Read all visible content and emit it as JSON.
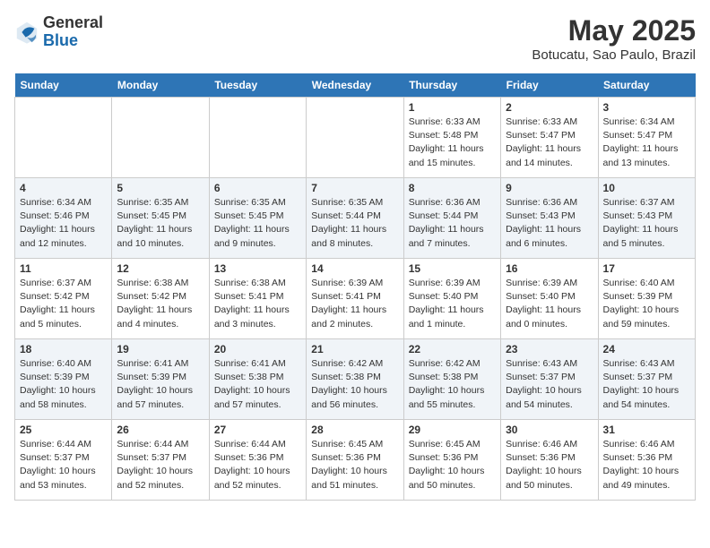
{
  "header": {
    "logo_general": "General",
    "logo_blue": "Blue",
    "month_year": "May 2025",
    "location": "Botucatu, Sao Paulo, Brazil"
  },
  "days_of_week": [
    "Sunday",
    "Monday",
    "Tuesday",
    "Wednesday",
    "Thursday",
    "Friday",
    "Saturday"
  ],
  "weeks": [
    [
      {
        "day": "",
        "info": ""
      },
      {
        "day": "",
        "info": ""
      },
      {
        "day": "",
        "info": ""
      },
      {
        "day": "",
        "info": ""
      },
      {
        "day": "1",
        "info": "Sunrise: 6:33 AM\nSunset: 5:48 PM\nDaylight: 11 hours and 15 minutes."
      },
      {
        "day": "2",
        "info": "Sunrise: 6:33 AM\nSunset: 5:47 PM\nDaylight: 11 hours and 14 minutes."
      },
      {
        "day": "3",
        "info": "Sunrise: 6:34 AM\nSunset: 5:47 PM\nDaylight: 11 hours and 13 minutes."
      }
    ],
    [
      {
        "day": "4",
        "info": "Sunrise: 6:34 AM\nSunset: 5:46 PM\nDaylight: 11 hours and 12 minutes."
      },
      {
        "day": "5",
        "info": "Sunrise: 6:35 AM\nSunset: 5:45 PM\nDaylight: 11 hours and 10 minutes."
      },
      {
        "day": "6",
        "info": "Sunrise: 6:35 AM\nSunset: 5:45 PM\nDaylight: 11 hours and 9 minutes."
      },
      {
        "day": "7",
        "info": "Sunrise: 6:35 AM\nSunset: 5:44 PM\nDaylight: 11 hours and 8 minutes."
      },
      {
        "day": "8",
        "info": "Sunrise: 6:36 AM\nSunset: 5:44 PM\nDaylight: 11 hours and 7 minutes."
      },
      {
        "day": "9",
        "info": "Sunrise: 6:36 AM\nSunset: 5:43 PM\nDaylight: 11 hours and 6 minutes."
      },
      {
        "day": "10",
        "info": "Sunrise: 6:37 AM\nSunset: 5:43 PM\nDaylight: 11 hours and 5 minutes."
      }
    ],
    [
      {
        "day": "11",
        "info": "Sunrise: 6:37 AM\nSunset: 5:42 PM\nDaylight: 11 hours and 5 minutes."
      },
      {
        "day": "12",
        "info": "Sunrise: 6:38 AM\nSunset: 5:42 PM\nDaylight: 11 hours and 4 minutes."
      },
      {
        "day": "13",
        "info": "Sunrise: 6:38 AM\nSunset: 5:41 PM\nDaylight: 11 hours and 3 minutes."
      },
      {
        "day": "14",
        "info": "Sunrise: 6:39 AM\nSunset: 5:41 PM\nDaylight: 11 hours and 2 minutes."
      },
      {
        "day": "15",
        "info": "Sunrise: 6:39 AM\nSunset: 5:40 PM\nDaylight: 11 hours and 1 minute."
      },
      {
        "day": "16",
        "info": "Sunrise: 6:39 AM\nSunset: 5:40 PM\nDaylight: 11 hours and 0 minutes."
      },
      {
        "day": "17",
        "info": "Sunrise: 6:40 AM\nSunset: 5:39 PM\nDaylight: 10 hours and 59 minutes."
      }
    ],
    [
      {
        "day": "18",
        "info": "Sunrise: 6:40 AM\nSunset: 5:39 PM\nDaylight: 10 hours and 58 minutes."
      },
      {
        "day": "19",
        "info": "Sunrise: 6:41 AM\nSunset: 5:39 PM\nDaylight: 10 hours and 57 minutes."
      },
      {
        "day": "20",
        "info": "Sunrise: 6:41 AM\nSunset: 5:38 PM\nDaylight: 10 hours and 57 minutes."
      },
      {
        "day": "21",
        "info": "Sunrise: 6:42 AM\nSunset: 5:38 PM\nDaylight: 10 hours and 56 minutes."
      },
      {
        "day": "22",
        "info": "Sunrise: 6:42 AM\nSunset: 5:38 PM\nDaylight: 10 hours and 55 minutes."
      },
      {
        "day": "23",
        "info": "Sunrise: 6:43 AM\nSunset: 5:37 PM\nDaylight: 10 hours and 54 minutes."
      },
      {
        "day": "24",
        "info": "Sunrise: 6:43 AM\nSunset: 5:37 PM\nDaylight: 10 hours and 54 minutes."
      }
    ],
    [
      {
        "day": "25",
        "info": "Sunrise: 6:44 AM\nSunset: 5:37 PM\nDaylight: 10 hours and 53 minutes."
      },
      {
        "day": "26",
        "info": "Sunrise: 6:44 AM\nSunset: 5:37 PM\nDaylight: 10 hours and 52 minutes."
      },
      {
        "day": "27",
        "info": "Sunrise: 6:44 AM\nSunset: 5:36 PM\nDaylight: 10 hours and 52 minutes."
      },
      {
        "day": "28",
        "info": "Sunrise: 6:45 AM\nSunset: 5:36 PM\nDaylight: 10 hours and 51 minutes."
      },
      {
        "day": "29",
        "info": "Sunrise: 6:45 AM\nSunset: 5:36 PM\nDaylight: 10 hours and 50 minutes."
      },
      {
        "day": "30",
        "info": "Sunrise: 6:46 AM\nSunset: 5:36 PM\nDaylight: 10 hours and 50 minutes."
      },
      {
        "day": "31",
        "info": "Sunrise: 6:46 AM\nSunset: 5:36 PM\nDaylight: 10 hours and 49 minutes."
      }
    ]
  ]
}
